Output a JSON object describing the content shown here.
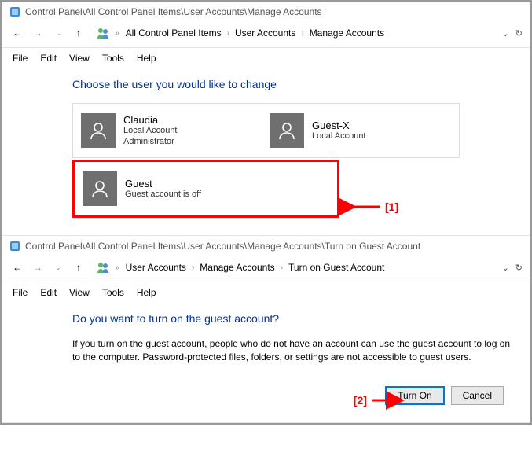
{
  "window1": {
    "title": "Control Panel\\All Control Panel Items\\User Accounts\\Manage Accounts",
    "breadcrumbs": [
      "All Control Panel Items",
      "User Accounts",
      "Manage Accounts"
    ],
    "menu": {
      "file": "File",
      "edit": "Edit",
      "view": "View",
      "tools": "Tools",
      "help": "Help"
    },
    "heading": "Choose the user you would like to change",
    "accounts": [
      {
        "name": "Claudia",
        "line1": "Local Account",
        "line2": "Administrator"
      },
      {
        "name": "Guest-X",
        "line1": "Local Account",
        "line2": ""
      },
      {
        "name": "Guest",
        "line1": "Guest account is off",
        "line2": ""
      }
    ],
    "annotation": "[1]"
  },
  "window2": {
    "title": "Control Panel\\All Control Panel Items\\User Accounts\\Manage Accounts\\Turn on Guest Account",
    "breadcrumbs": [
      "User Accounts",
      "Manage Accounts",
      "Turn on Guest Account"
    ],
    "menu": {
      "file": "File",
      "edit": "Edit",
      "view": "View",
      "tools": "Tools",
      "help": "Help"
    },
    "heading": "Do you want to turn on the guest account?",
    "body": "If you turn on the guest account, people who do not have an account can use the guest account to log on to the computer. Password-protected files, folders, or settings are not accessible to guest users.",
    "buttons": {
      "turn_on": "Turn On",
      "cancel": "Cancel"
    },
    "annotation": "[2]"
  }
}
